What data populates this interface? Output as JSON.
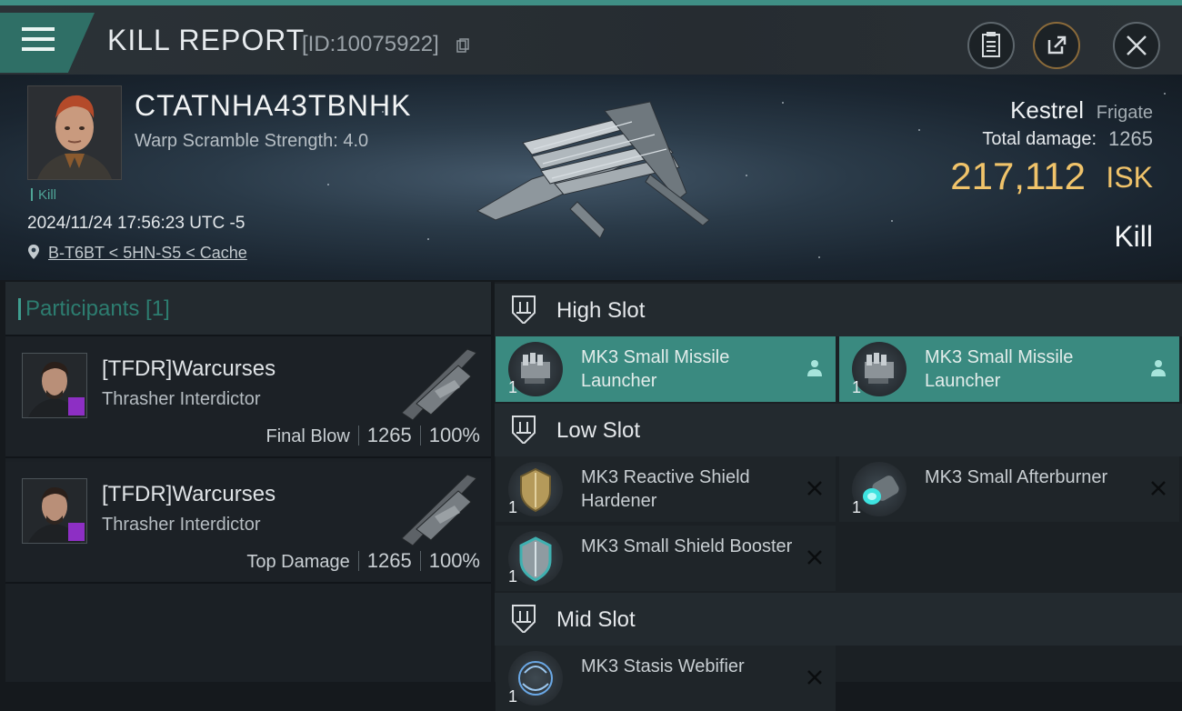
{
  "header": {
    "title": "KILL REPORT",
    "report_id": "[ID:10075922]",
    "icons": [
      "menu-icon",
      "copy-icon",
      "clipboard-icon",
      "share-icon",
      "close-icon"
    ]
  },
  "victim": {
    "name": "CTATNHA43TBNHK",
    "warp_scramble": "Warp Scramble Strength: 4.0",
    "tag": "Kill",
    "date": "2024/11/24 17:56:23 UTC -5",
    "location": "B-T6BT < 5HN-S5 < Cache",
    "ship_name": "Kestrel",
    "ship_class": "Frigate",
    "total_damage_label": "Total damage:",
    "total_damage_value": "1265",
    "isk_value": "217,112",
    "isk_unit": "ISK",
    "status": "Kill"
  },
  "participants": {
    "title": "Participants [1]",
    "rows": [
      {
        "name": "[TFDR]Warcurses",
        "ship": "Thrasher Interdictor",
        "role": "Final Blow",
        "damage": "1265",
        "percent": "100%"
      },
      {
        "name": "[TFDR]Warcurses",
        "ship": "Thrasher Interdictor",
        "role": "Top Damage",
        "damage": "1265",
        "percent": "100%"
      }
    ]
  },
  "fitting": {
    "high_slot": {
      "title": "High Slot",
      "modules": [
        {
          "name": "MK3 Small Missile Launcher",
          "qty": "1"
        },
        {
          "name": "MK3 Small Missile Launcher",
          "qty": "1"
        }
      ]
    },
    "low_slot": {
      "title": "Low Slot",
      "modules": [
        {
          "name": "MK3 Reactive Shield Hardener",
          "qty": "1"
        },
        {
          "name": "MK3 Small Afterburner",
          "qty": "1"
        },
        {
          "name": "MK3 Small Shield Booster",
          "qty": "1"
        }
      ]
    },
    "mid_slot": {
      "title": "Mid Slot",
      "modules": [
        {
          "name": "MK3 Stasis Webifier",
          "qty": "1"
        }
      ]
    }
  },
  "colors": {
    "accent": "#3a8a80",
    "isk": "#f0c36a",
    "badge": "#8d2fc4"
  }
}
